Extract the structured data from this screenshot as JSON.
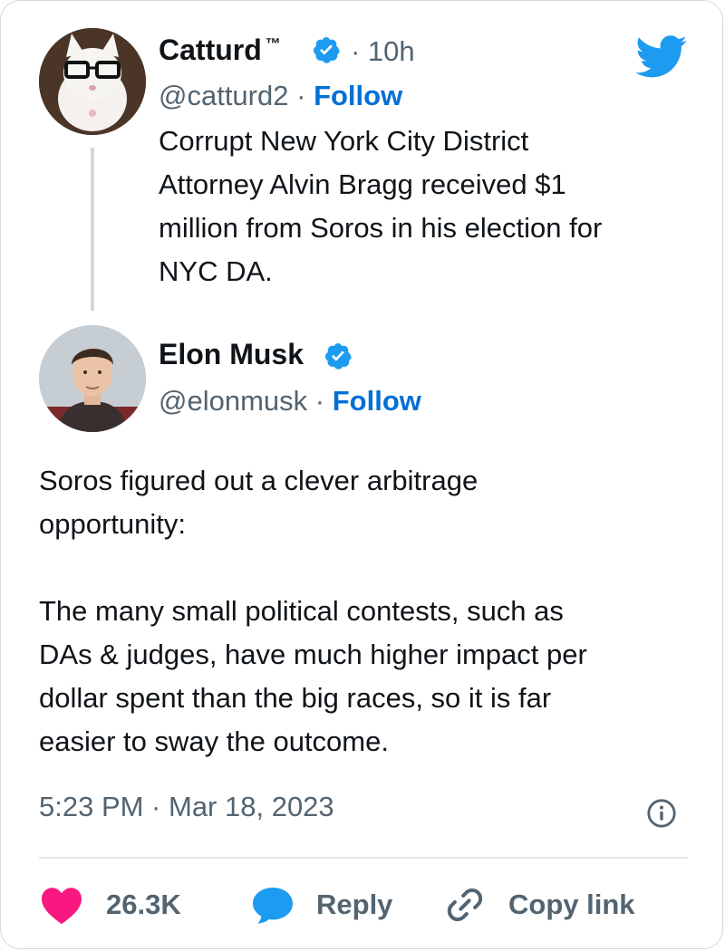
{
  "colors": {
    "accent": "#1d9bf0",
    "follow": "#006fd6",
    "heart": "#f91880",
    "muted": "#536471",
    "text": "#0f1419"
  },
  "quoted_tweet": {
    "author_name": "Catturd",
    "author_mark": "™",
    "verified": true,
    "time_ago": "· 10h",
    "handle": "@catturd2",
    "separator": "·",
    "follow_label": "Follow",
    "text": "Corrupt New York City District\nAttorney Alvin Bragg received $1\nmillion from Soros in his election for\nNYC DA.",
    "avatar_icon": "cat-with-glasses-avatar"
  },
  "main_tweet": {
    "author_name": "Elon Musk",
    "verified": true,
    "handle": "@elonmusk",
    "separator": "·",
    "follow_label": "Follow",
    "text": "Soros figured out a clever arbitrage\nopportunity:\n\nThe many small political contests, such as\nDAs & judges, have much higher impact per\ndollar spent than the big races, so it is far\neasier to sway the outcome.",
    "avatar_icon": "person-avatar",
    "timestamp": "5:23 PM · Mar 18, 2023"
  },
  "actions": {
    "like_count": "26.3K",
    "reply_label": "Reply",
    "copy_link_label": "Copy link"
  },
  "icons": [
    "twitter-bird-icon",
    "verified-badge-icon",
    "info-icon",
    "heart-icon",
    "reply-bubble-icon",
    "link-icon"
  ]
}
